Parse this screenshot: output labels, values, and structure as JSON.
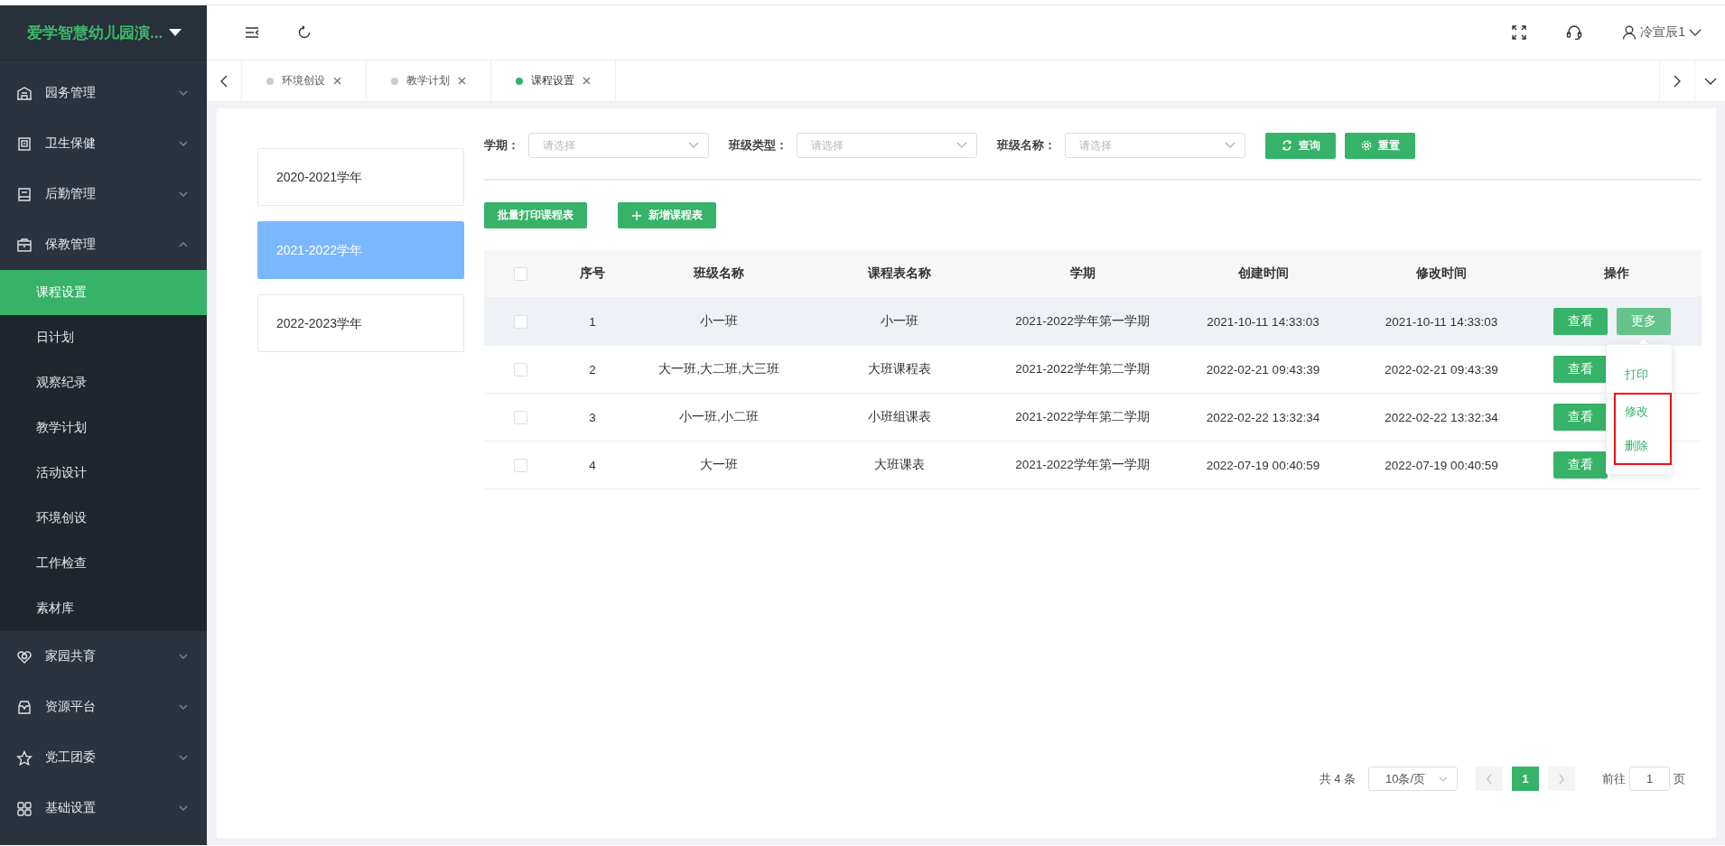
{
  "sidebar": {
    "title": "爱学智慧幼儿园演...",
    "items": [
      {
        "label": "园务管理",
        "expanded": false
      },
      {
        "label": "卫生保健",
        "expanded": false
      },
      {
        "label": "后勤管理",
        "expanded": false
      },
      {
        "label": "保教管理",
        "expanded": true,
        "children": [
          {
            "label": "课程设置",
            "selected": true
          },
          {
            "label": "日计划",
            "selected": false
          },
          {
            "label": "观察纪录",
            "selected": false
          },
          {
            "label": "教学计划",
            "selected": false
          },
          {
            "label": "活动设计",
            "selected": false
          },
          {
            "label": "环境创设",
            "selected": false
          },
          {
            "label": "工作检查",
            "selected": false
          },
          {
            "label": "素材库",
            "selected": false
          }
        ]
      },
      {
        "label": "家园共育",
        "expanded": false
      },
      {
        "label": "资源平台",
        "expanded": false
      },
      {
        "label": "党工团委",
        "expanded": false
      },
      {
        "label": "基础设置",
        "expanded": false
      }
    ]
  },
  "header": {
    "user": "冷宣辰1"
  },
  "tabs": [
    {
      "label": "环境创设",
      "selected": false
    },
    {
      "label": "教学计划",
      "selected": false
    },
    {
      "label": "课程设置",
      "selected": true
    }
  ],
  "years": [
    {
      "label": "2020-2021学年",
      "selected": false
    },
    {
      "label": "2021-2022学年",
      "selected": true
    },
    {
      "label": "2022-2023学年",
      "selected": false
    }
  ],
  "filters": [
    {
      "label": "学期：",
      "placeholder": "请选择"
    },
    {
      "label": "班级类型：",
      "placeholder": "请选择"
    },
    {
      "label": "班级名称：",
      "placeholder": "请选择"
    }
  ],
  "filter_buttons": [
    {
      "kind": "search",
      "label": "查询"
    },
    {
      "kind": "reset",
      "label": "重置"
    }
  ],
  "action_buttons": [
    {
      "kind": "print",
      "label": "批量打印课程表"
    },
    {
      "kind": "add",
      "label": "新增课程表"
    }
  ],
  "table": {
    "select_all_checked": false,
    "columns": [
      "序号",
      "班级名称",
      "课程表名称",
      "学期",
      "创建时间",
      "修改时间",
      "操作"
    ],
    "rows": [
      {
        "checked": false,
        "highlighted": true,
        "cells": [
          "1",
          "小一班",
          "小一班",
          "2021-2022学年第一学期",
          "2021-10-11 14:33:03",
          "2021-10-11 14:33:03"
        ],
        "actions": [
          {
            "label": "查看",
            "active": false
          },
          {
            "label": "更多",
            "active": true
          }
        ]
      },
      {
        "checked": false,
        "highlighted": false,
        "cells": [
          "2",
          "大一班,大二班,大三班",
          "大班课程表",
          "2021-2022学年第二学期",
          "2022-02-21 09:43:39",
          "2022-02-21 09:43:39"
        ],
        "actions": [
          {
            "label": "查看",
            "active": false
          }
        ]
      },
      {
        "checked": false,
        "highlighted": false,
        "cells": [
          "3",
          "小一班,小二班",
          "小班组课表",
          "2021-2022学年第二学期",
          "2022-02-22 13:32:34",
          "2022-02-22 13:32:34"
        ],
        "actions": [
          {
            "label": "查看",
            "active": false
          }
        ]
      },
      {
        "checked": false,
        "highlighted": false,
        "cells": [
          "4",
          "大一班",
          "大班课表",
          "2021-2022学年第一学期",
          "2022-07-19 00:40:59",
          "2022-07-19 00:40:59"
        ],
        "actions": [
          {
            "label": "查看",
            "active": false
          }
        ]
      }
    ]
  },
  "more_menu": {
    "items": [
      {
        "label": "打印",
        "highlighted": false
      },
      {
        "label": "修改",
        "highlighted": true
      },
      {
        "label": "删除",
        "highlighted": true
      }
    ]
  },
  "pagination": {
    "total": "共 4 条",
    "page_size": "10条/页",
    "pages": [
      {
        "label": "1",
        "selected": true
      }
    ],
    "goto_label": "前往",
    "goto_value": "1",
    "goto_suffix": "页"
  }
}
